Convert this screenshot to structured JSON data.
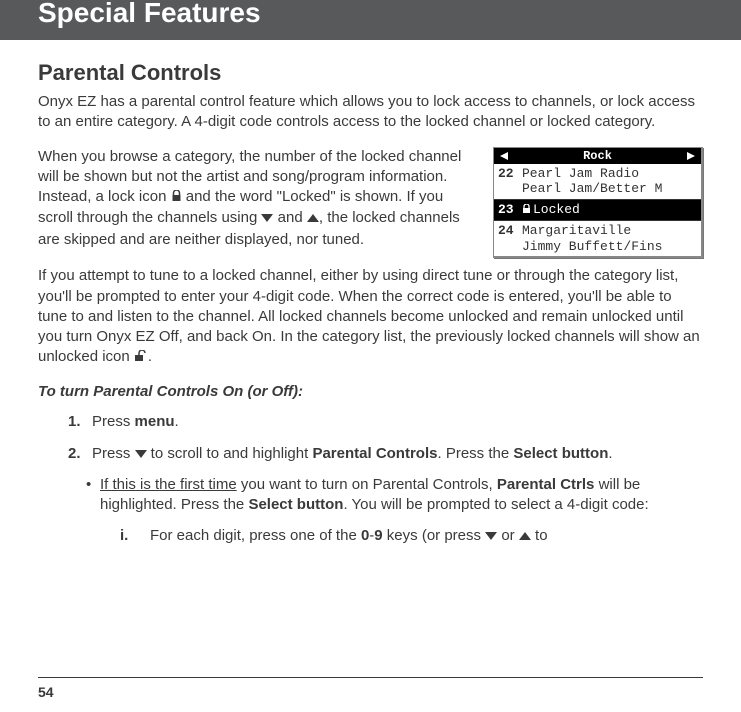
{
  "header": {
    "title": "Special Features"
  },
  "section": {
    "title": "Parental Controls",
    "p1": "Onyx EZ has a parental control feature which allows you to lock access to channels, or lock access to an entire category. A 4-digit code controls access to the locked channel or locked category.",
    "p2a": "When you browse a category, the number of the locked channel will be shown but not the artist and song/program information. Instead, a lock icon ",
    "p2b": " and the word \"Locked\" is shown. If you scroll through the channels using ",
    "p2c": " and ",
    "p2d": ", the locked channels are skipped and are neither displayed, nor tuned.",
    "p3a": "If you attempt to tune to a locked channel, either by using direct tune or through the category list, you'll be prompted to enter your 4-digit code. When the correct code is entered, you'll be able to tune to and listen to the channel. All locked channels become unlocked and remain unlocked until you turn Onyx EZ Off, and back On. In the category list, the previously locked channels will show an unlocked icon ",
    "p3b": "."
  },
  "screen": {
    "category": "Rock",
    "rows": [
      {
        "num": "22",
        "line1": "Pearl Jam Radio",
        "line2": "Pearl Jam/Better M"
      },
      {
        "num": "23",
        "locked_label": "Locked"
      },
      {
        "num": "24",
        "line1": "Margaritaville",
        "line2": "Jimmy Buffett/Fins"
      }
    ]
  },
  "instructions": {
    "heading": "To turn Parental Controls On (or Off):",
    "items": {
      "1": {
        "num": "1.",
        "prefix": "Press ",
        "menu": "menu",
        "suffix": "."
      },
      "2": {
        "num": "2.",
        "a1": "Press ",
        "a2": " to scroll to and highlight ",
        "pc": "Parental Controls",
        "a3": ". Press the ",
        "sb": "Select button",
        "a4": ".",
        "bullet": {
          "mark": "•",
          "u1": "If this is the first time",
          "t1": " you want to turn on Parental Controls, ",
          "pc2": "Parental Ctrls",
          "t2": " will be highlighted. Press the ",
          "sb2": "Select button",
          "t3": ". You will be prompted to select a 4-digit code:"
        },
        "sub": {
          "num": "i.",
          "t1": "For each digit, press one of the ",
          "keys1": "0",
          "dash": "-",
          "keys2": "9",
          "t2": " keys (or press ",
          "t3": " or ",
          "t4": " to"
        }
      }
    }
  },
  "page": "54"
}
